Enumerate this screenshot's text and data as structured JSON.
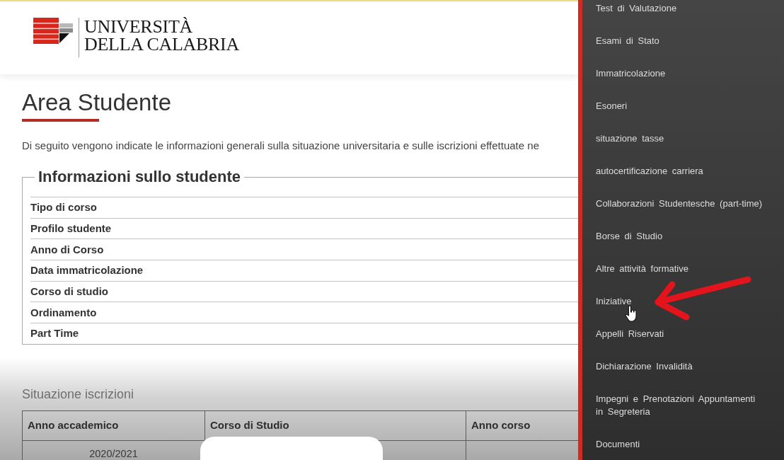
{
  "header": {
    "wordmark": [
      "UNIVERSITÀ",
      "DELLA CALABRIA"
    ]
  },
  "page": {
    "title": "Area Studente",
    "intro": "Di seguito vengono indicate le informazioni generali sulla situazione universitaria e sulle iscrizioni effettuate ne"
  },
  "student_info": {
    "legend": "Informazioni sullo studente",
    "rows": [
      {
        "label": "Tipo di corso"
      },
      {
        "label": "Profilo studente"
      },
      {
        "label": "Anno di Corso"
      },
      {
        "label": "Data immatricolazione"
      },
      {
        "label": "Corso di studio"
      },
      {
        "label": "Ordinamento"
      },
      {
        "label": "Part Time"
      }
    ]
  },
  "enrollments": {
    "title": "Situazione iscrizioni",
    "columns": [
      "Anno accademico",
      "Corso di Studio",
      "Anno corso"
    ],
    "rows": [
      {
        "cells": [
          "2020/2021"
        ]
      }
    ]
  },
  "side_menu": {
    "items": [
      {
        "label": "Test di Valutazione"
      },
      {
        "label": "Esami di Stato"
      },
      {
        "label": "Immatricolazione"
      },
      {
        "label": "Esoneri"
      },
      {
        "label": "situazione tasse"
      },
      {
        "label": "autocertificazione carriera"
      },
      {
        "label": "Collaborazioni Studentesche (part-time)"
      },
      {
        "label": "Borse di Studio"
      },
      {
        "label": "Altre attività formative"
      },
      {
        "label": "Iniziative"
      },
      {
        "label": "Appelli Riservati"
      },
      {
        "label": "Dichiarazione Invalidità"
      },
      {
        "label": "Impegni e Prenotazioni Appuntamenti in Segreteria"
      },
      {
        "label": "Documenti"
      }
    ]
  }
}
